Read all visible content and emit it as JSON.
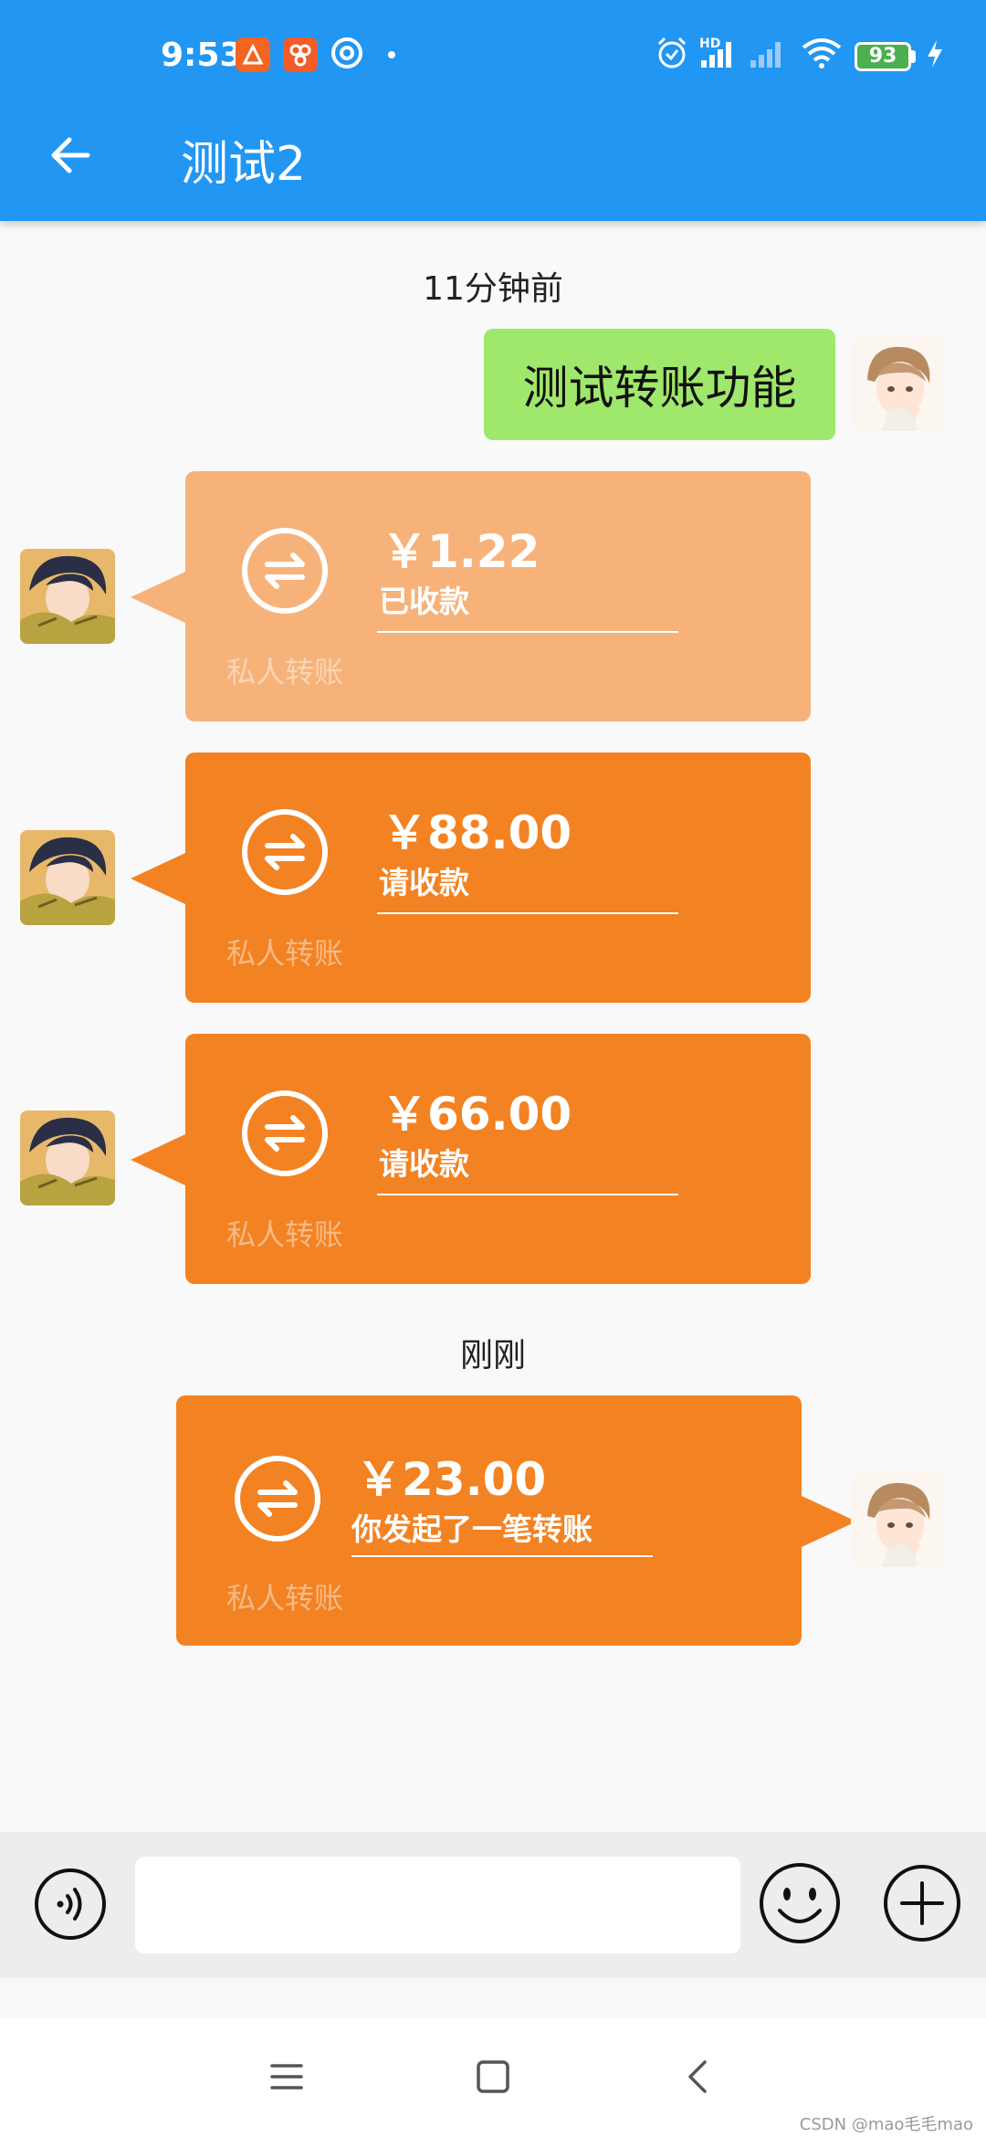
{
  "status_bar": {
    "time": "9:53",
    "battery": "93",
    "hd_label": "HD",
    "icons": [
      "app-icon",
      "app-icon",
      "app-icon",
      "alarm-icon",
      "signal-icon",
      "signal-icon",
      "wifi-icon",
      "battery-icon",
      "charging-icon"
    ]
  },
  "header": {
    "title": "测试2",
    "back_icon": "arrow-left-icon"
  },
  "messages": {
    "time_1": "11分钟前",
    "text_1": "测试转账功能",
    "transfer_1": {
      "amount": "￥1.22",
      "status": "已收款",
      "caption": "私人转账"
    },
    "transfer_2": {
      "amount": "￥88.00",
      "status": "请收款",
      "caption": "私人转账"
    },
    "transfer_3": {
      "amount": "￥66.00",
      "status": "请收款",
      "caption": "私人转账"
    },
    "time_2": "刚刚",
    "transfer_4": {
      "amount": "￥23.00",
      "status": "你发起了一笔转账",
      "caption": "私人转账"
    }
  },
  "input_bar": {
    "voice_icon": "voice-icon",
    "emoji_icon": "smiley-icon",
    "more_icon": "plus-circle-icon",
    "placeholder": ""
  },
  "navigation_bar": {
    "icons": [
      "menu-icon",
      "home-icon",
      "back-icon"
    ]
  },
  "watermark": "CSDN @mao毛毛mao",
  "colors": {
    "app_bar": "#2196f3",
    "transfer": "#f38222",
    "transfer_received": "#f7b27a",
    "text_bubble": "#9fe86b"
  }
}
